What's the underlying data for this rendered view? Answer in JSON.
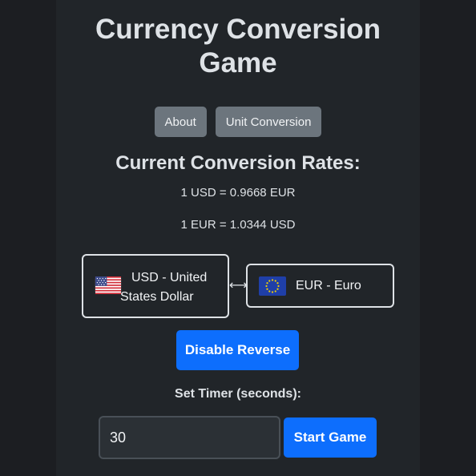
{
  "title": {
    "line1": "Currency Conversion",
    "line2": "Game"
  },
  "nav": {
    "about_label": "About",
    "unit_conversion_label": "Unit Conversion"
  },
  "rates": {
    "heading": "Current Conversion Rates:",
    "usd_to_eur": "1 USD = 0.9668 EUR",
    "eur_to_usd": "1 EUR = 1.0344 USD"
  },
  "from_currency": {
    "flag_icon": "us-flag-icon",
    "label_line1": "USD - United",
    "label_line2": "States Dollar"
  },
  "swap_symbol": "⟷",
  "to_currency": {
    "flag_icon": "eu-flag-icon",
    "label": "EUR - Euro"
  },
  "reverse_button_label": "Disable Reverse",
  "timer": {
    "label": "Set Timer (seconds):",
    "value": "30"
  },
  "start_button_label": "Start Game",
  "colors": {
    "page_background": "#1c1e22",
    "panel_background": "#212529",
    "primary_button": "#0d6efd",
    "secondary_button": "#6c757d"
  }
}
